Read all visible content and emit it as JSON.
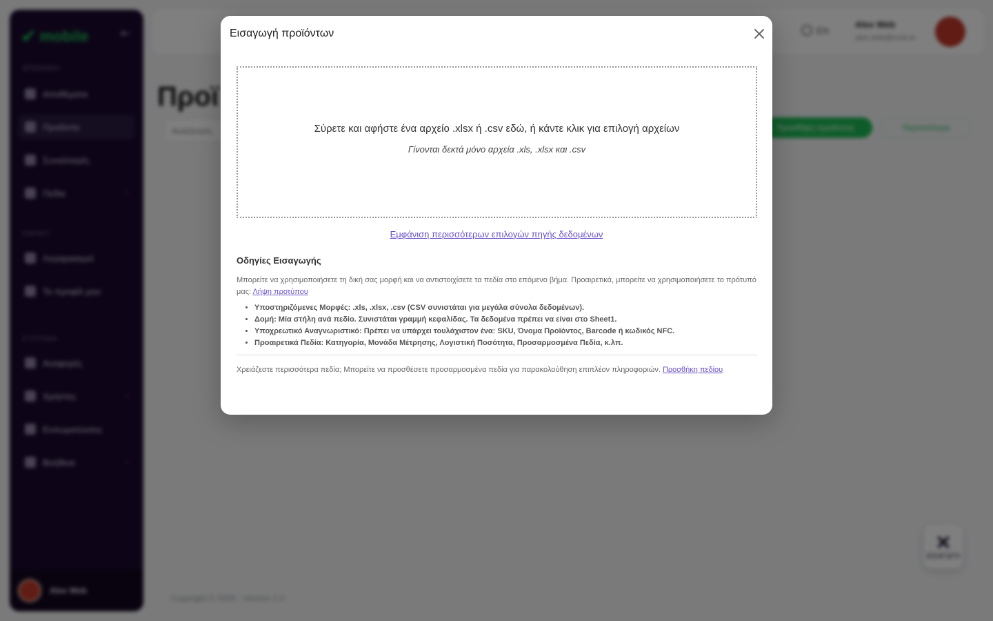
{
  "background": {
    "sidebar": {
      "logo": "mobile",
      "sections": [
        "ΑΠΟΘΗΚΗ",
        "ΠΑΡΑΓΓ.",
        "ΣΥΣΤΗΜΑ"
      ],
      "items": [
        {
          "label": "Αποθέματα"
        },
        {
          "label": "Προϊόντα"
        },
        {
          "label": "Συναλλαγές"
        },
        {
          "label": "Πεδία"
        },
        {
          "label": "Λογαριασμοί"
        },
        {
          "label": "Το προφίλ μου"
        },
        {
          "label": "Αναφορές"
        },
        {
          "label": "Χρήστες"
        },
        {
          "label": "Ενσωματώσεις"
        },
        {
          "label": "Βοήθεια"
        }
      ],
      "user_name": "Alex Web"
    },
    "topbar": {
      "language": "EN",
      "user_name": "Alex Web",
      "user_email": "alex.web@mob.io"
    },
    "page_title": "Προϊ",
    "search_placeholder": "Αναζήτηση",
    "add_button": "Προσθήκη προϊόντος",
    "more_button": "Περισσότερα",
    "copyright": "Copyright © 2026 - Version 1.0",
    "fab_label": "ΕΙΣΑΓΩΓΗ"
  },
  "modal": {
    "title": "Εισαγωγή προϊόντων",
    "dropzone": {
      "main_text": "Σύρετε και αφήστε ένα αρχείο .xlsx ή .csv εδώ, ή κάντε κλικ για επιλογή αρχείων",
      "sub_text": "Γίνονται δεκτά μόνο αρχεία .xls, .xlsx και .csv"
    },
    "more_sources_link": "Εμφάνιση περισσότερων επιλογών πηγής δεδομένων",
    "instructions": {
      "heading": "Οδηγίες Εισαγωγής",
      "intro": "Μπορείτε να χρησιμοποιήσετε τη δική σας μορφή και να αντιστοιχίσετε τα πεδία στο επόμενο βήμα. Προαιρετικά, μπορείτε να χρησιμοποιήσετε το πρότυπό μας: ",
      "template_link": "Λήψη προτύπου",
      "bullets": [
        "Υποστηριζόμενες Μορφές: .xls, .xlsx, .csv (CSV συνιστάται για μεγάλα σύνολα δεδομένων).",
        "Δομή: Μία στήλη ανά πεδίο. Συνιστάται γραμμή κεφαλίδας. Τα δεδομένα πρέπει να είναι στο Sheet1.",
        "Υποχρεωτικό Αναγνωριστικό: Πρέπει να υπάρχει τουλάχιστον ένα: SKU, Όνομα Προϊόντος, Barcode ή κωδικός NFC.",
        "Προαιρετικά Πεδία: Κατηγορία, Μονάδα Μέτρησης, Λογιστική Ποσότητα, Προσαρμοσμένα Πεδία, κ.λπ."
      ]
    },
    "extra_fields": {
      "text": "Χρειάζεστε περισσότερα πεδία; Μπορείτε να προσθέσετε προσαρμοσμένα πεδία για παρακολούθηση επιπλέον πληροφοριών. ",
      "link": "Προσθήκη πεδίου"
    }
  }
}
